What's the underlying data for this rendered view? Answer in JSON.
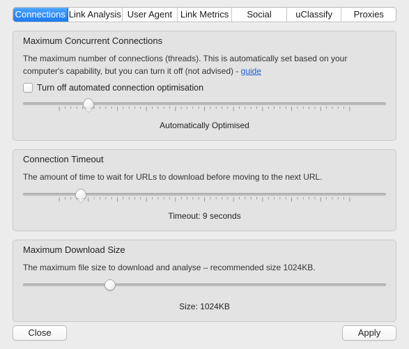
{
  "tabs": [
    {
      "label": "Connections"
    },
    {
      "label": "Link Analysis"
    },
    {
      "label": "User Agent"
    },
    {
      "label": "Link Metrics"
    },
    {
      "label": "Social"
    },
    {
      "label": "uClassify"
    },
    {
      "label": "Proxies"
    }
  ],
  "section_concurrent": {
    "legend": "Maximum Concurrent Connections",
    "desc_pre": "The maximum number of connections (threads). This is automatically set based on your computer's capability, but you can turn it off (not advised) - ",
    "guide_link": "guide",
    "checkbox_label": "Turn off automated connection optimisation",
    "slider": {
      "position_percent": 18,
      "ticks_major": 11,
      "ticks_minor": 51
    },
    "caption": "Automatically Optimised"
  },
  "section_timeout": {
    "legend": "Connection Timeout",
    "desc": "The amount of time to wait for URLs to download before moving to the next URL.",
    "slider": {
      "position_percent": 16,
      "ticks_major": 11,
      "ticks_minor": 51
    },
    "caption": "Timeout: 9 seconds",
    "value_seconds": 9
  },
  "section_download": {
    "legend": "Maximum Download Size",
    "desc": "The maximum file size to download and analyse – recommended size 1024KB.",
    "slider": {
      "position_percent": 24,
      "ticks_major": 0,
      "ticks_minor": 0
    },
    "caption": "Size: 1024KB",
    "value_kb": 1024
  },
  "buttons": {
    "close": "Close",
    "apply": "Apply"
  }
}
